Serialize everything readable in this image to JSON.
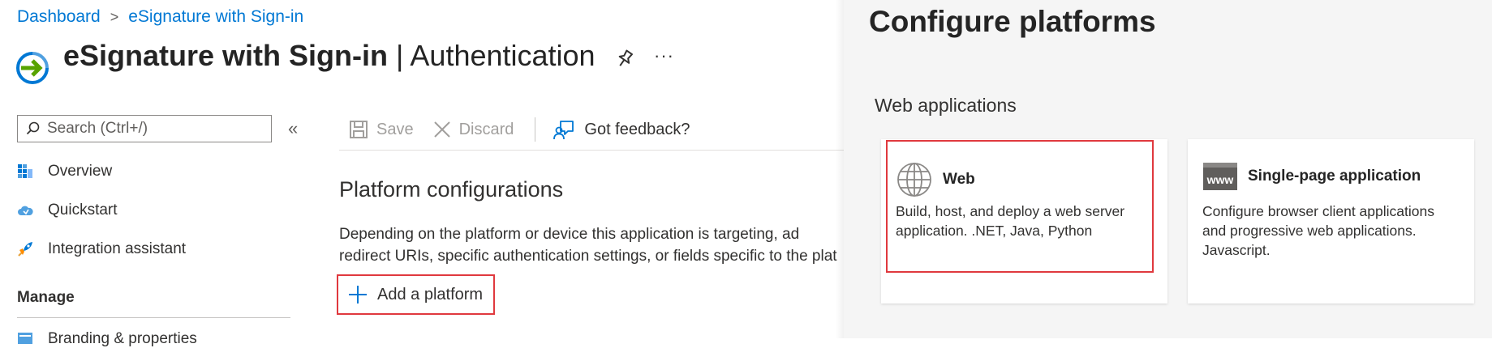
{
  "breadcrumb": {
    "items": [
      "Dashboard",
      "eSignature with Sign-in"
    ],
    "separator": ">"
  },
  "header": {
    "app_name": "eSignature with Sign-in",
    "separator": "|",
    "page": "Authentication",
    "more_label": "···"
  },
  "sidebar": {
    "search_placeholder": "Search (Ctrl+/)",
    "collapse_label": "«",
    "items": [
      {
        "label": "Overview",
        "icon": "overview-icon"
      },
      {
        "label": "Quickstart",
        "icon": "cloud-icon"
      },
      {
        "label": "Integration assistant",
        "icon": "rocket-icon"
      }
    ],
    "manage_label": "Manage",
    "partial_item": "Branding & properties"
  },
  "toolbar": {
    "save_label": "Save",
    "discard_label": "Discard",
    "feedback_label": "Got feedback?"
  },
  "main": {
    "section_title": "Platform configurations",
    "description_line1": "Depending on the platform or device this application is targeting, ad",
    "description_line2": "redirect URIs, specific authentication settings, or fields specific to the plat",
    "add_platform_label": "Add a platform"
  },
  "panel": {
    "title": "Configure platforms",
    "subtitle": "Web applications",
    "cards": [
      {
        "title": "Web",
        "description": "Build, host, and deploy a web server application. .NET, Java, Python",
        "icon": "globe-icon"
      },
      {
        "title": "Single-page application",
        "description": "Configure browser client applications and progressive web applications. Javascript.",
        "icon": "www-icon",
        "icon_text": "www"
      }
    ]
  },
  "colors": {
    "accent": "#0078d4",
    "highlight": "#e0393e",
    "panel_bg": "#f5f5f5"
  }
}
